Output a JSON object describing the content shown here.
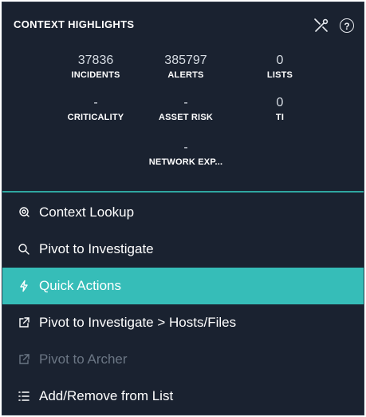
{
  "header": {
    "title": "CONTEXT HIGHLIGHTS",
    "icons": [
      "tools-icon",
      "help-icon"
    ],
    "help_glyph": "?"
  },
  "metrics": [
    {
      "value": "37836",
      "label": "INCIDENTS"
    },
    {
      "value": "385797",
      "label": "ALERTS"
    },
    {
      "value": "0",
      "label": "LISTS"
    },
    {
      "value": "-",
      "label": "CRITICALITY"
    },
    {
      "value": "-",
      "label": "ASSET RISK"
    },
    {
      "value": "0",
      "label": "TI"
    },
    {
      "value": "-",
      "label": "NETWORK EXP..."
    }
  ],
  "menu": [
    {
      "label": "Context Lookup",
      "icon": "lookup-icon",
      "state": "normal"
    },
    {
      "label": "Pivot to Investigate",
      "icon": "search-icon",
      "state": "normal"
    },
    {
      "label": "Quick Actions",
      "icon": "lightning-icon",
      "state": "active"
    },
    {
      "label": "Pivot to Investigate > Hosts/Files",
      "icon": "external-link-icon",
      "state": "normal"
    },
    {
      "label": "Pivot to Archer",
      "icon": "external-link-icon",
      "state": "disabled"
    },
    {
      "label": "Add/Remove from List",
      "icon": "list-icon",
      "state": "normal"
    }
  ],
  "colors": {
    "panel_bg": "#1a2230",
    "accent": "#36bdb8",
    "divider": "#2fa7a0",
    "disabled_text": "#6b7684"
  }
}
